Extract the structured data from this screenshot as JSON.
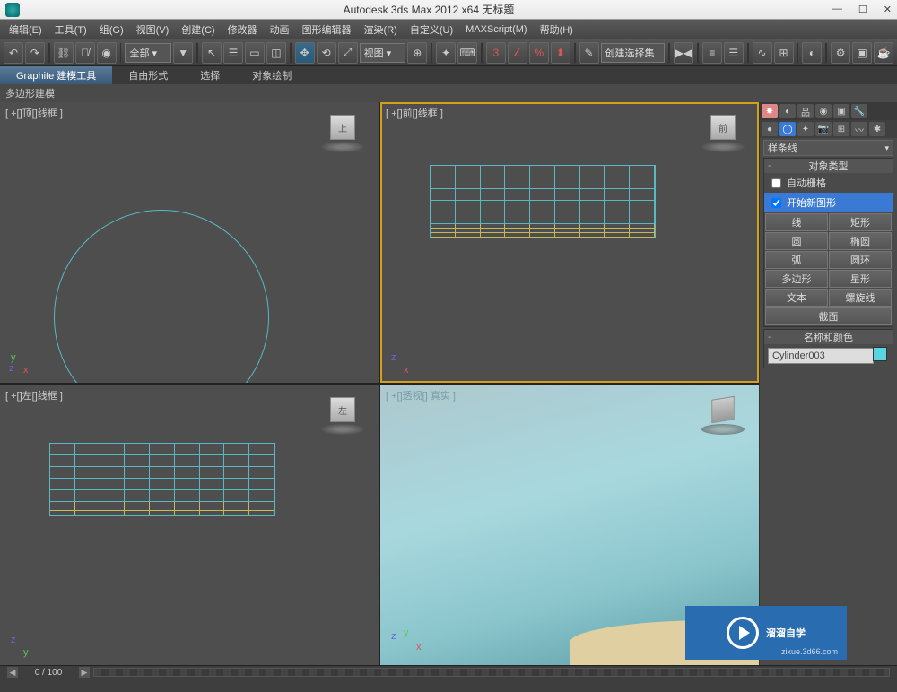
{
  "title": "Autodesk 3ds Max  2012 x64      无标题",
  "menus": [
    "编辑(E)",
    "工具(T)",
    "组(G)",
    "视图(V)",
    "创建(C)",
    "修改器",
    "动画",
    "图形编辑器",
    "渲染(R)",
    "自定义(U)",
    "MAXScript(M)",
    "帮助(H)"
  ],
  "toolbar": {
    "scope_drop": "全部 ▾",
    "view_drop": "视图 ▾",
    "selset_drop": "创建选择集"
  },
  "ribbon": {
    "tabs": [
      "Graphite 建模工具",
      "自由形式",
      "选择",
      "对象绘制"
    ],
    "bar_label": "多边形建模"
  },
  "viewports": {
    "top": "[ +[]顶[]线框 ]",
    "front": "[ +[]前[]线框 ]",
    "left": "[ +[]左[]线框 ]",
    "persp": "[ +[]透视[] 真实 ]",
    "cube_top": "上",
    "cube_front": "前",
    "cube_left": "左"
  },
  "axes": {
    "x": "x",
    "y": "y",
    "z": "z"
  },
  "panel": {
    "category": "样条线",
    "sec_type": "对象类型",
    "auto_grid": "自动栅格",
    "start_new": "开始新图形",
    "buttons": [
      "线",
      "矩形",
      "圆",
      "椭圆",
      "弧",
      "圆环",
      "多边形",
      "星形",
      "文本",
      "螺旋线",
      "截面"
    ],
    "sec_name": "名称和颜色",
    "obj_name": "Cylinder003"
  },
  "timeline": {
    "pos": "0 / 100"
  },
  "watermark": {
    "brand": "溜溜自学",
    "url": "zixue.3d66.com"
  }
}
